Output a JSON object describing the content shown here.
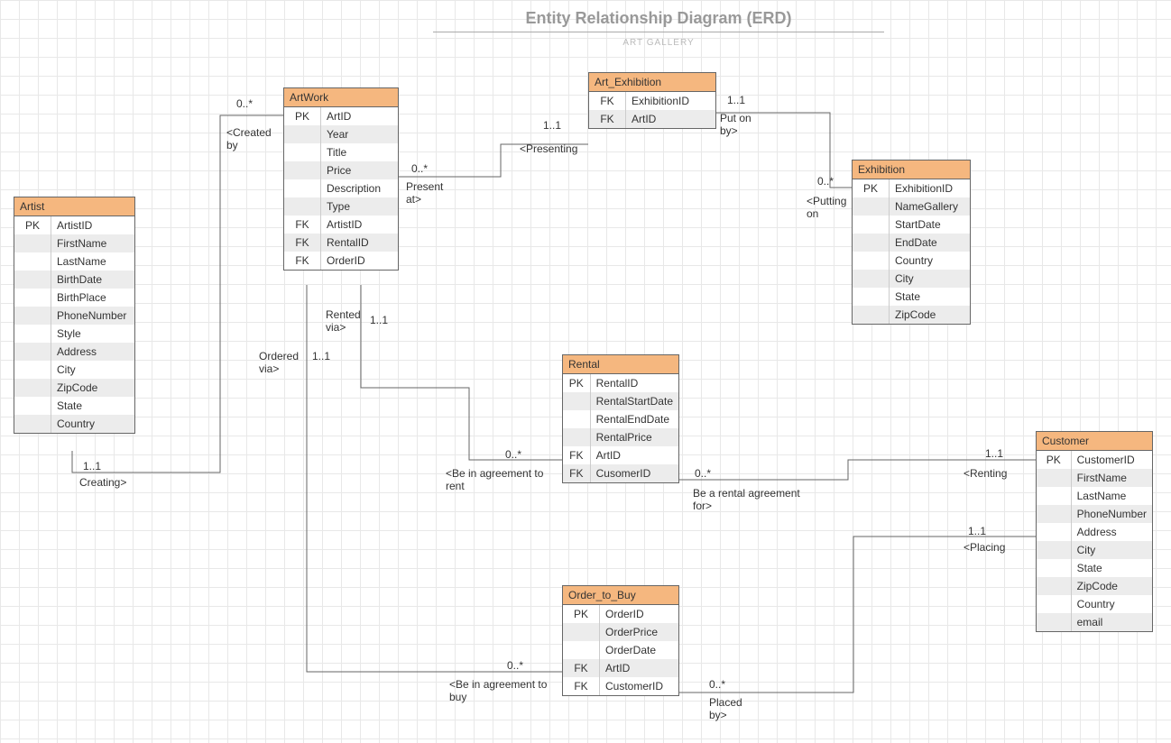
{
  "header": {
    "title": "Entity Relationship Diagram (ERD)",
    "subtitle": "ART GALLERY"
  },
  "entities": {
    "artist": {
      "name": "Artist",
      "rows": [
        {
          "key": "PK",
          "attr": "ArtistID"
        },
        {
          "key": "",
          "attr": "FirstName"
        },
        {
          "key": "",
          "attr": "LastName"
        },
        {
          "key": "",
          "attr": "BirthDate"
        },
        {
          "key": "",
          "attr": "BirthPlace"
        },
        {
          "key": "",
          "attr": "PhoneNumber"
        },
        {
          "key": "",
          "attr": "Style"
        },
        {
          "key": "",
          "attr": "Address"
        },
        {
          "key": "",
          "attr": "City"
        },
        {
          "key": "",
          "attr": "ZipCode"
        },
        {
          "key": "",
          "attr": "State"
        },
        {
          "key": "",
          "attr": "Country"
        }
      ]
    },
    "artwork": {
      "name": "ArtWork",
      "rows": [
        {
          "key": "PK",
          "attr": "ArtID"
        },
        {
          "key": "",
          "attr": "Year"
        },
        {
          "key": "",
          "attr": "Title"
        },
        {
          "key": "",
          "attr": "Price"
        },
        {
          "key": "",
          "attr": "Description"
        },
        {
          "key": "",
          "attr": "Type"
        },
        {
          "key": "FK",
          "attr": "ArtistID"
        },
        {
          "key": "FK",
          "attr": "RentalID"
        },
        {
          "key": "FK",
          "attr": "OrderID"
        }
      ]
    },
    "artexhibition": {
      "name": "Art_Exhibition",
      "rows": [
        {
          "key": "FK",
          "attr": "ExhibitionID"
        },
        {
          "key": "FK",
          "attr": "ArtID"
        }
      ]
    },
    "exhibition": {
      "name": "Exhibition",
      "rows": [
        {
          "key": "PK",
          "attr": "ExhibitionID"
        },
        {
          "key": "",
          "attr": "NameGallery"
        },
        {
          "key": "",
          "attr": "StartDate"
        },
        {
          "key": "",
          "attr": "EndDate"
        },
        {
          "key": "",
          "attr": "Country"
        },
        {
          "key": "",
          "attr": "City"
        },
        {
          "key": "",
          "attr": "State"
        },
        {
          "key": "",
          "attr": "ZipCode"
        }
      ]
    },
    "rental": {
      "name": "Rental",
      "rows": [
        {
          "key": "PK",
          "attr": "RentalID"
        },
        {
          "key": "",
          "attr": "RentalStartDate"
        },
        {
          "key": "",
          "attr": "RentalEndDate"
        },
        {
          "key": "",
          "attr": "RentalPrice"
        },
        {
          "key": "FK",
          "attr": "ArtID"
        },
        {
          "key": "FK",
          "attr": "CusomerID"
        }
      ]
    },
    "order": {
      "name": "Order_to_Buy",
      "rows": [
        {
          "key": "PK",
          "attr": "OrderID"
        },
        {
          "key": "",
          "attr": "OrderPrice"
        },
        {
          "key": "",
          "attr": "OrderDate"
        },
        {
          "key": "FK",
          "attr": "ArtID"
        },
        {
          "key": "FK",
          "attr": "CustomerID"
        }
      ]
    },
    "customer": {
      "name": "Customer",
      "rows": [
        {
          "key": "PK",
          "attr": "CustomerID"
        },
        {
          "key": "",
          "attr": "FirstName"
        },
        {
          "key": "",
          "attr": "LastName"
        },
        {
          "key": "",
          "attr": "PhoneNumber"
        },
        {
          "key": "",
          "attr": "Address"
        },
        {
          "key": "",
          "attr": "City"
        },
        {
          "key": "",
          "attr": "State"
        },
        {
          "key": "",
          "attr": "ZipCode"
        },
        {
          "key": "",
          "attr": "Country"
        },
        {
          "key": "",
          "attr": "email"
        }
      ]
    }
  },
  "labels": {
    "created_by_card": "0..*",
    "created_by_text": "<Created\nby",
    "creating_card": "1..1",
    "creating_text": "Creating>",
    "presenting_card": "1..1",
    "presenting_text": "<Presenting",
    "present_at_card": "0..*",
    "present_at_text": "Present\nat>",
    "put_on_by_card": "1..1",
    "put_on_by_text": "Put on\nby>",
    "putting_on_card": "0..*",
    "putting_on_text": "<Putting\non",
    "rented_via_text": "Rented\nvia>",
    "rented_via_card": "1..1",
    "ordered_via_text": "Ordered\nvia>",
    "ordered_via_card": "1..1",
    "agree_rent_card": "0..*",
    "agree_rent_text": "<Be in agreement to\nrent",
    "rental_for_card": "0..*",
    "rental_for_text": "Be a rental agreement\nfor>",
    "renting_card": "1..1",
    "renting_text": "<Renting",
    "placing_card": "1..1",
    "placing_text": "<Placing",
    "agree_buy_card": "0..*",
    "agree_buy_text": "<Be in agreement to\nbuy",
    "placed_by_card": "0..*",
    "placed_by_text": "Placed\nby>"
  }
}
